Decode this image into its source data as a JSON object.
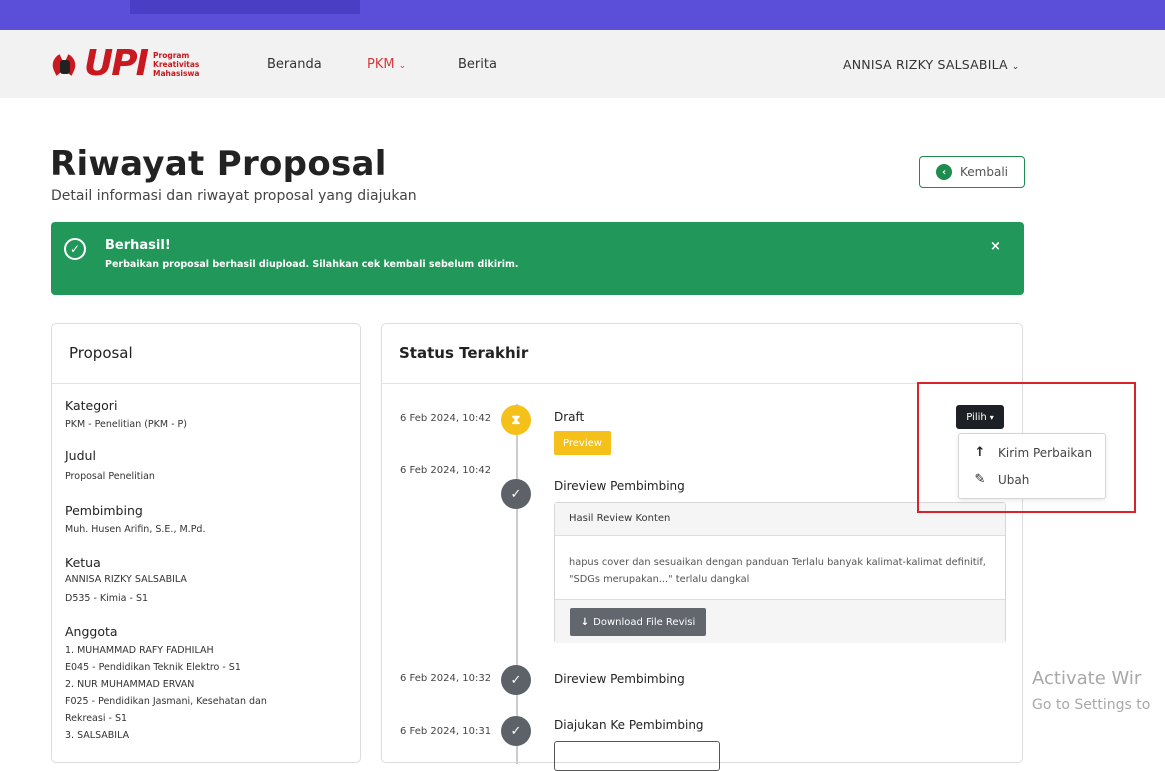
{
  "header": {
    "logo_word": "UPI",
    "logo_sub": [
      "Program",
      "Kreativitas",
      "Mahasiswa"
    ],
    "nav": {
      "beranda": "Beranda",
      "pkm": "PKM",
      "berita": "Berita",
      "user": "ANNISA RIZKY SALSABILA"
    }
  },
  "page": {
    "title": "Riwayat Proposal",
    "subtitle": "Detail informasi dan riwayat proposal yang diajukan",
    "back_label": "Kembali"
  },
  "alert": {
    "title": "Berhasil!",
    "message": "Perbaikan proposal berhasil diupload. Silahkan cek kembali sebelum dikirim.",
    "close": "×"
  },
  "proposal": {
    "heading": "Proposal",
    "kategori_label": "Kategori",
    "kategori": "PKM - Penelitian (PKM - P)",
    "judul_label": "Judul",
    "judul": "Proposal Penelitian",
    "pembimbing_label": "Pembimbing",
    "pembimbing": "Muh. Husen Arifin, S.E., M.Pd.",
    "ketua_label": "Ketua",
    "ketua_name": "ANNISA RIZKY SALSABILA",
    "ketua_info": "D535 - Kimia - S1",
    "anggota_label": "Anggota",
    "anggota": [
      "1. MUHAMMAD RAFY FADHILAH",
      "E045 - Pendidikan Teknik Elektro - S1",
      "2. NUR MUHAMMAD ERVAN",
      "F025 - Pendidikan Jasmani, Kesehatan dan",
      "Rekreasi - S1",
      "3. SALSABILA"
    ]
  },
  "status": {
    "heading": "Status Terakhir",
    "entries": [
      {
        "time": "6 Feb 2024, 10:42",
        "label": "Draft",
        "icon": "hourglass-icon"
      },
      {
        "time": "6 Feb 2024, 10:42",
        "label": "Direview Pembimbing",
        "icon": "check-icon"
      },
      {
        "time": "6 Feb 2024, 10:32",
        "label": "Direview Pembimbing",
        "icon": "check-icon"
      },
      {
        "time": "6 Feb 2024, 10:31",
        "label": "Diajukan Ke Pembimbing",
        "icon": "check-icon"
      }
    ],
    "preview_label": "Preview",
    "review": {
      "heading": "Hasil Review Konten",
      "body": "hapus cover dan sesuaikan dengan panduan Terlalu banyak kalimat-kalimat definitif, \"SDGs merupakan...\" terlalu dangkal",
      "download_label": "Download File Revisi"
    }
  },
  "actions": {
    "pilih_label": "Pilih",
    "menu": [
      "Kirim Perbaikan",
      "Ubah"
    ]
  },
  "watermark": {
    "line1": "Activate Wir",
    "line2": "Go to Settings to"
  },
  "colors": {
    "topbar": "#5b4fd9",
    "brand_red": "#c9181f",
    "success": "#21975a",
    "warning": "#f5c01a",
    "dark": "#1d2126",
    "highlight": "#d9232a"
  }
}
